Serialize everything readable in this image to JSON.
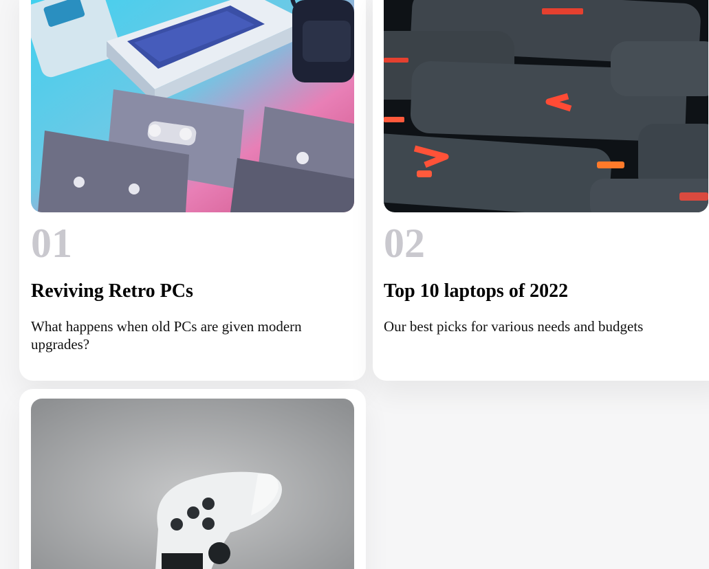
{
  "cards": [
    {
      "number": "01",
      "title": "Reviving Retro PCs",
      "description": "What happens when old PCs are given modern upgrades?",
      "image": "retro-computers-image"
    },
    {
      "number": "02",
      "title": "Top 10 laptops of 2022",
      "description": "Our best picks for various needs and budgets",
      "image": "keyboard-closeup-image"
    },
    {
      "number": "",
      "title": "",
      "description": "",
      "image": "game-controller-image"
    }
  ],
  "colors": {
    "page_background": "#f6f6f7",
    "card_background": "#ffffff",
    "number_color": "#c9c8ce",
    "title_color": "#000000"
  }
}
